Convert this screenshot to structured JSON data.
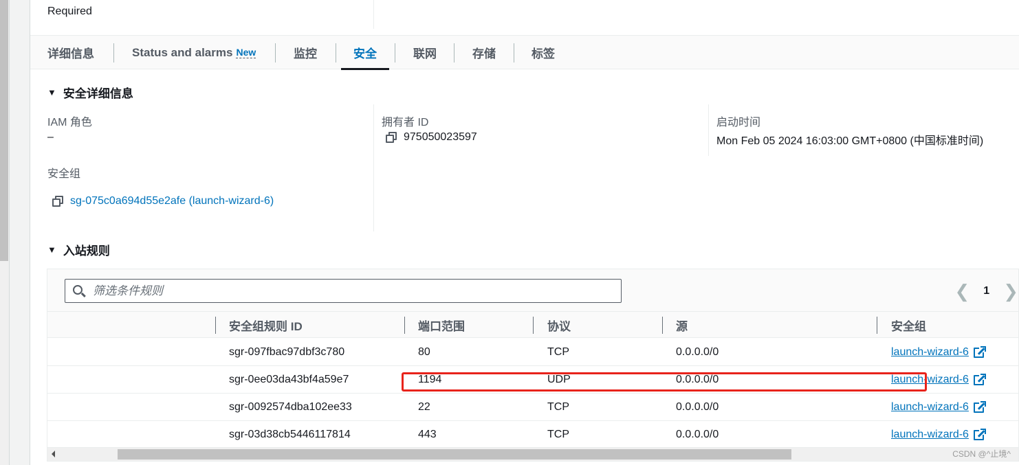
{
  "top": {
    "required_label": "Required"
  },
  "tabs": [
    {
      "label": "详细信息",
      "active": false
    },
    {
      "label": "Status and alarms",
      "badge": "New",
      "active": false
    },
    {
      "label": "监控",
      "active": false
    },
    {
      "label": "安全",
      "active": true
    },
    {
      "label": "联网",
      "active": false
    },
    {
      "label": "存储",
      "active": false
    },
    {
      "label": "标签",
      "active": false
    }
  ],
  "security_details": {
    "title": "安全详细信息",
    "iam_role_label": "IAM 角色",
    "iam_role_value": "–",
    "security_group_label": "安全组",
    "security_group_value": "sg-075c0a694d55e2afe (launch-wizard-6)",
    "owner_id_label": "拥有者 ID",
    "owner_id_value": "975050023597",
    "launch_time_label": "启动时间",
    "launch_time_value": "Mon Feb 05 2024 16:03:00 GMT+0800 (中国标准时间)"
  },
  "inbound_rules": {
    "title": "入站规则",
    "filter_placeholder": "筛选条件规则",
    "filter_value": "",
    "pagination": {
      "current_page": "1",
      "prev_icon": "chevron-left-icon",
      "next_icon": "chevron-right-icon"
    },
    "columns": [
      "安全组规则 ID",
      "端口范围",
      "协议",
      "源",
      "安全组"
    ],
    "rows": [
      {
        "rule_id": "sgr-097fbac97dbf3c780",
        "port_range": "80",
        "protocol": "TCP",
        "source": "0.0.0.0/0",
        "security_group": "launch-wizard-6"
      },
      {
        "rule_id": "sgr-0ee03da43bf4a59e7",
        "port_range": "1194",
        "protocol": "UDP",
        "source": "0.0.0.0/0",
        "security_group": "launch-wizard-6",
        "highlighted": true
      },
      {
        "rule_id": "sgr-0092574dba102ee33",
        "port_range": "22",
        "protocol": "TCP",
        "source": "0.0.0.0/0",
        "security_group": "launch-wizard-6"
      },
      {
        "rule_id": "sgr-03d38cb5446117814",
        "port_range": "443",
        "protocol": "TCP",
        "source": "0.0.0.0/0",
        "security_group": "launch-wizard-6"
      }
    ]
  },
  "colors": {
    "accent": "#0073bb",
    "active_tab_underline": "#16191f",
    "highlight": "#e8231b"
  },
  "watermark": "CSDN @^止境^"
}
